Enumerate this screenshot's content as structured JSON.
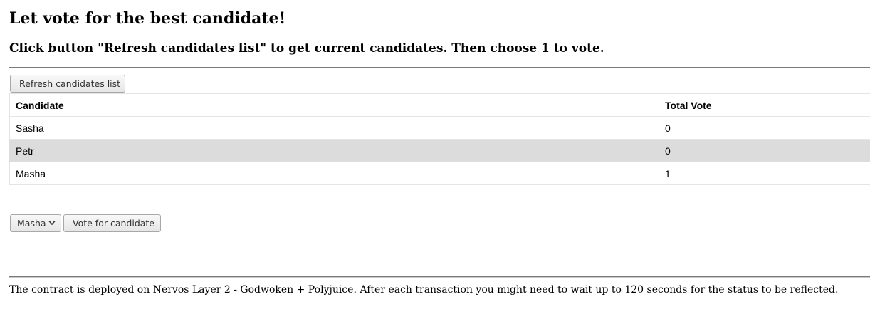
{
  "header": {
    "title": "Let vote for the best candidate!",
    "subtitle": "Click button \"Refresh candidates list\" to get current candidates. Then choose 1 to vote."
  },
  "toolbar": {
    "refresh_label": "Refresh candidates list"
  },
  "table": {
    "columns": [
      "Candidate",
      "Total Vote"
    ],
    "rows": [
      {
        "candidate": "Sasha",
        "votes": "0"
      },
      {
        "candidate": "Petr",
        "votes": "0"
      },
      {
        "candidate": "Masha",
        "votes": "1"
      }
    ]
  },
  "vote_form": {
    "selected_candidate": "Masha",
    "vote_label": "Vote for candidate",
    "chevron_icon": "chevron-down-icon"
  },
  "footer": {
    "note": "The contract is deployed on Nervos Layer 2 - Godwoken + Polyjuice. After each transaction you might need to wait up to 120 seconds for the status to be reflected."
  },
  "colors": {
    "shaded_row": "#dcdcdc",
    "rule": "#7a7a7a"
  }
}
